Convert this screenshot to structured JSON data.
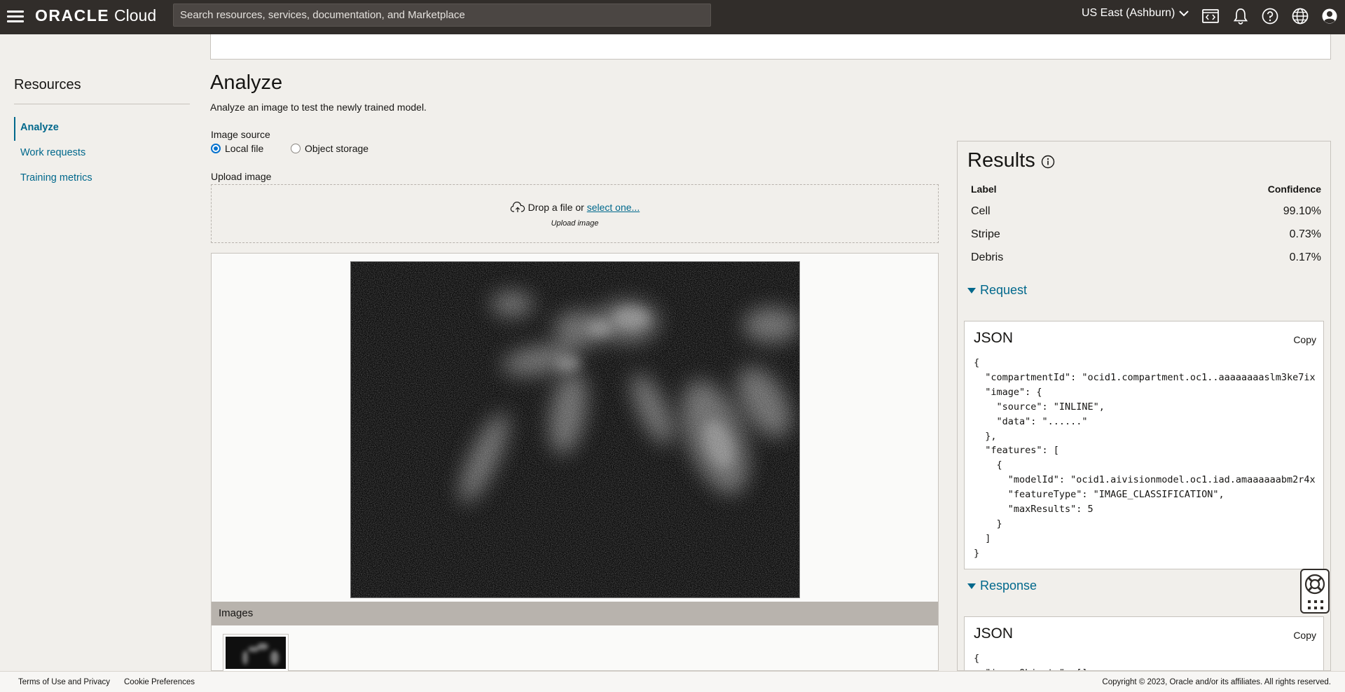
{
  "header": {
    "brand_oracle": "ORACLE",
    "brand_cloud": "Cloud",
    "search_placeholder": "Search resources, services, documentation, and Marketplace",
    "region": "US East (Ashburn)"
  },
  "sidebar": {
    "title": "Resources",
    "items": [
      {
        "label": "Analyze",
        "active": true
      },
      {
        "label": "Work requests",
        "active": false
      },
      {
        "label": "Training metrics",
        "active": false
      }
    ]
  },
  "main": {
    "title": "Analyze",
    "description": "Analyze an image to test the newly trained model.",
    "image_source_label": "Image source",
    "source_options": [
      {
        "label": "Local file",
        "checked": true
      },
      {
        "label": "Object storage",
        "checked": false
      }
    ],
    "upload_label": "Upload image",
    "drop_text": "Drop a file or",
    "drop_link": "select one...",
    "drop_sub": "Upload image",
    "images_bar": "Images"
  },
  "results": {
    "title": "Results",
    "columns": [
      "Label",
      "Confidence"
    ],
    "rows": [
      {
        "label": "Cell",
        "confidence": "99.10%"
      },
      {
        "label": "Stripe",
        "confidence": "0.73%"
      },
      {
        "label": "Debris",
        "confidence": "0.17%"
      }
    ],
    "request": {
      "heading": "Request",
      "json_title": "JSON",
      "copy_label": "Copy",
      "code": "{\n  \"compartmentId\": \"ocid1.compartment.oc1..aaaaaaaaslm3ke7ix\n  \"image\": {\n    \"source\": \"INLINE\",\n    \"data\": \"......\"\n  },\n  \"features\": [\n    {\n      \"modelId\": \"ocid1.aivisionmodel.oc1.iad.amaaaaaabm2r4x\n      \"featureType\": \"IMAGE_CLASSIFICATION\",\n      \"maxResults\": 5\n    }\n  ]\n}"
    },
    "response": {
      "heading": "Response",
      "json_title": "JSON",
      "copy_label": "Copy",
      "code": "{\n  \"imageObjects\": [],"
    }
  },
  "footer": {
    "terms": "Terms of Use and Privacy",
    "cookies": "Cookie Preferences",
    "copyright": "Copyright © 2023, Oracle and/or its affiliates. All rights reserved."
  }
}
